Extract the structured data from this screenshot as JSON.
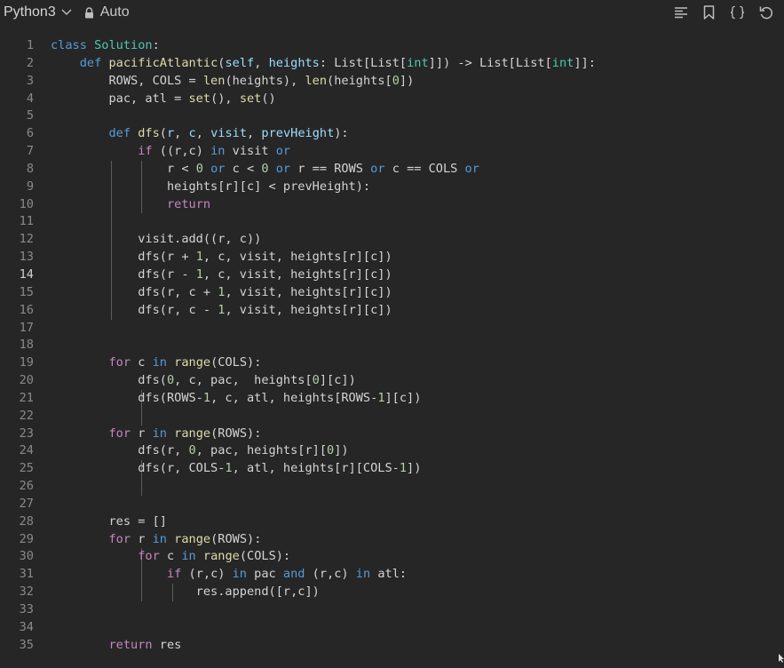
{
  "toolbar": {
    "language": "Python3",
    "mode": "Auto",
    "icons": [
      "list-icon",
      "bookmark-icon",
      "braces-icon",
      "undo-icon"
    ]
  },
  "editor": {
    "current_line": 14,
    "lines": [
      {
        "n": "1",
        "code": "class Solution:"
      },
      {
        "n": "2",
        "code": "    def pacificAtlantic(self, heights: List[List[int]]) -> List[List[int]]:"
      },
      {
        "n": "3",
        "code": "        ROWS, COLS = len(heights), len(heights[0])"
      },
      {
        "n": "4",
        "code": "        pac, atl = set(), set()"
      },
      {
        "n": "5",
        "code": ""
      },
      {
        "n": "6",
        "code": "        def dfs(r, c, visit, prevHeight):"
      },
      {
        "n": "7",
        "code": "            if ((r,c) in visit or"
      },
      {
        "n": "8",
        "code": "                r < 0 or c < 0 or r == ROWS or c == COLS or"
      },
      {
        "n": "9",
        "code": "                heights[r][c] < prevHeight):"
      },
      {
        "n": "10",
        "code": "                return"
      },
      {
        "n": "11",
        "code": ""
      },
      {
        "n": "12",
        "code": "            visit.add((r, c))"
      },
      {
        "n": "13",
        "code": "            dfs(r + 1, c, visit, heights[r][c])"
      },
      {
        "n": "14",
        "code": "            dfs(r - 1, c, visit, heights[r][c])"
      },
      {
        "n": "15",
        "code": "            dfs(r, c + 1, visit, heights[r][c])"
      },
      {
        "n": "16",
        "code": "            dfs(r, c - 1, visit, heights[r][c])"
      },
      {
        "n": "17",
        "code": ""
      },
      {
        "n": "18",
        "code": ""
      },
      {
        "n": "19",
        "code": "        for c in range(COLS):"
      },
      {
        "n": "20",
        "code": "            dfs(0, c, pac,  heights[0][c])"
      },
      {
        "n": "21",
        "code": "            dfs(ROWS-1, c, atl, heights[ROWS-1][c])"
      },
      {
        "n": "22",
        "code": ""
      },
      {
        "n": "23",
        "code": "        for r in range(ROWS):"
      },
      {
        "n": "24",
        "code": "            dfs(r, 0, pac, heights[r][0])"
      },
      {
        "n": "25",
        "code": "            dfs(r, COLS-1, atl, heights[r][COLS-1])"
      },
      {
        "n": "26",
        "code": ""
      },
      {
        "n": "27",
        "code": ""
      },
      {
        "n": "28",
        "code": "        res = []"
      },
      {
        "n": "29",
        "code": "        for r in range(ROWS):"
      },
      {
        "n": "30",
        "code": "            for c in range(COLS):"
      },
      {
        "n": "31",
        "code": "                if (r,c) in pac and (r,c) in atl:"
      },
      {
        "n": "32",
        "code": "                    res.append([r,c])"
      },
      {
        "n": "33",
        "code": ""
      },
      {
        "n": "34",
        "code": ""
      },
      {
        "n": "35",
        "code": "        return res"
      }
    ]
  }
}
